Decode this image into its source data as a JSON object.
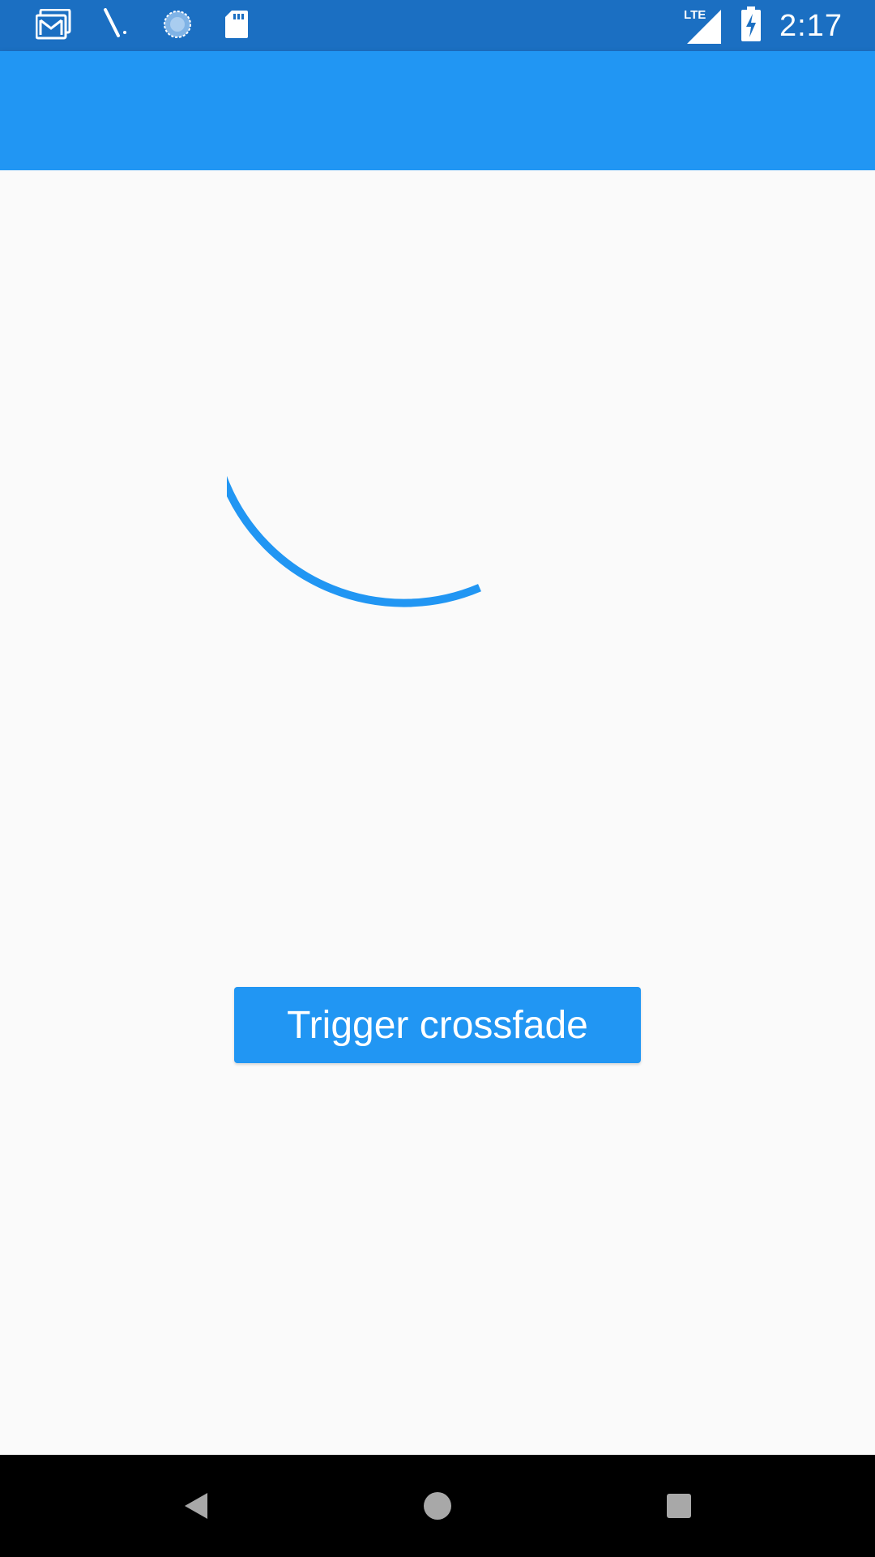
{
  "status_bar": {
    "time": "2:17",
    "network": "LTE",
    "left_icons": [
      "gmail-icon",
      "pen-icon",
      "sync-icon",
      "sd-card-icon"
    ],
    "right_icons": [
      "signal-icon",
      "battery-charging-icon"
    ]
  },
  "app_bar": {
    "color": "#2196f3"
  },
  "main": {
    "spinner_color": "#2196f3",
    "button_label": "Trigger crossfade"
  },
  "nav_bar": {
    "icons": [
      "back-icon",
      "home-icon",
      "recents-icon"
    ]
  }
}
